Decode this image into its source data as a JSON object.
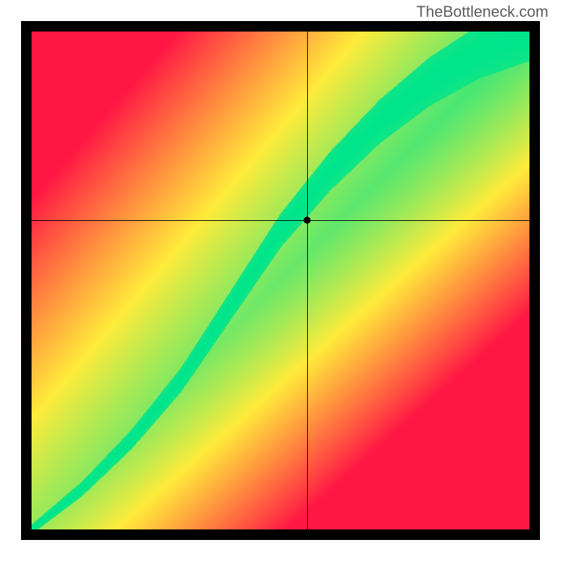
{
  "watermark": "TheBottleneck.com",
  "chart_data": {
    "type": "heatmap",
    "title": "",
    "xlabel": "",
    "ylabel": "",
    "xlim": [
      0,
      1
    ],
    "ylim": [
      0,
      1
    ],
    "marker": {
      "x": 0.555,
      "y": 0.62
    },
    "crosshair": {
      "x": 0.555,
      "y": 0.62
    },
    "ridge": [
      {
        "x": 0.0,
        "y": 0.0
      },
      {
        "x": 0.1,
        "y": 0.08
      },
      {
        "x": 0.2,
        "y": 0.18
      },
      {
        "x": 0.3,
        "y": 0.3
      },
      {
        "x": 0.4,
        "y": 0.45
      },
      {
        "x": 0.5,
        "y": 0.6
      },
      {
        "x": 0.6,
        "y": 0.72
      },
      {
        "x": 0.7,
        "y": 0.82
      },
      {
        "x": 0.8,
        "y": 0.9
      },
      {
        "x": 0.9,
        "y": 0.96
      },
      {
        "x": 1.0,
        "y": 1.0
      }
    ],
    "colorscale": {
      "0.0": "#ff1744",
      "0.5": "#ffeb3b",
      "1.0": "#00e58b"
    },
    "grid": false,
    "legend": false
  }
}
